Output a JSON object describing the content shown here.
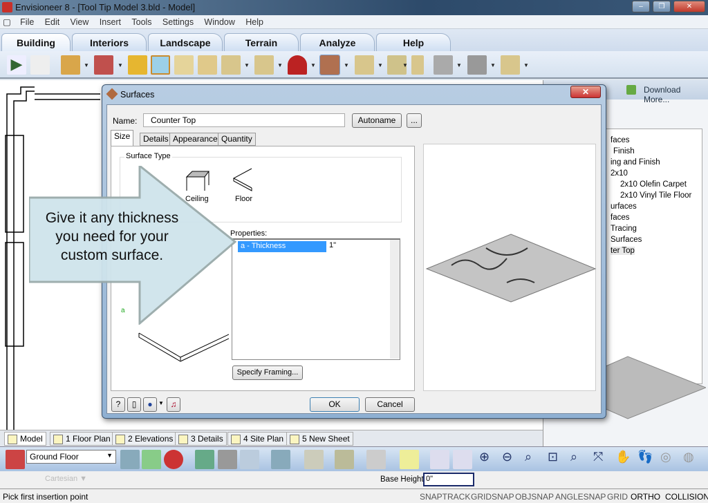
{
  "window": {
    "title": "Envisioneer 8 - [Tool Tip Model 3.bld - Model]"
  },
  "menu": [
    "File",
    "Edit",
    "View",
    "Insert",
    "Tools",
    "Settings",
    "Window",
    "Help"
  ],
  "ribbon_tabs": [
    "Building",
    "Interiors",
    "Landscape",
    "Terrain",
    "Analyze",
    "Help"
  ],
  "active_tab": "Building",
  "right_panel": {
    "download": "Download More...",
    "tree": [
      "faces",
      "Finish",
      "ing and Finish",
      "2x10",
      "2x10 Olefin Carpet",
      "2x10 Vinyl Tile Floor",
      "urfaces",
      "faces",
      "Tracing",
      "Surfaces",
      "ter Top"
    ]
  },
  "dialog": {
    "title": "Surfaces",
    "name_label": "Name:",
    "name_value": "Counter Top",
    "autoname": "Autoname",
    "ellipsis": "...",
    "tabs": [
      "Size",
      "Details",
      "Appearance",
      "Quantity"
    ],
    "active_tab": "Size",
    "surface_type_label": "Surface Type",
    "types": [
      "Ceiling",
      "Floor"
    ],
    "properties_label": "Properties:",
    "property_name": "a - Thickness",
    "property_value": "1\"",
    "specify_framing": "Specify Framing...",
    "ok": "OK",
    "cancel": "Cancel",
    "diagram_label": "a"
  },
  "callout": {
    "text": "Give it any thickness you need for your custom surface."
  },
  "sheet_tabs": [
    "Model",
    "1 Floor Plan",
    "2 Elevations",
    "3 Details",
    "4 Site Plan",
    "5 New Sheet"
  ],
  "bottom": {
    "floor": "Ground Floor",
    "coord_mode": "Cartesian",
    "base_height_label": "Base Height",
    "base_height_value": "0\""
  },
  "status": {
    "message": "Pick first insertion point",
    "flags": [
      "SNAPTRACK",
      "GRIDSNAP",
      "OBJSNAP",
      "ANGLESNAP",
      "GRID",
      "ORTHO",
      "COLLISION"
    ],
    "active_flags": [
      "ORTHO",
      "COLLISION"
    ]
  }
}
